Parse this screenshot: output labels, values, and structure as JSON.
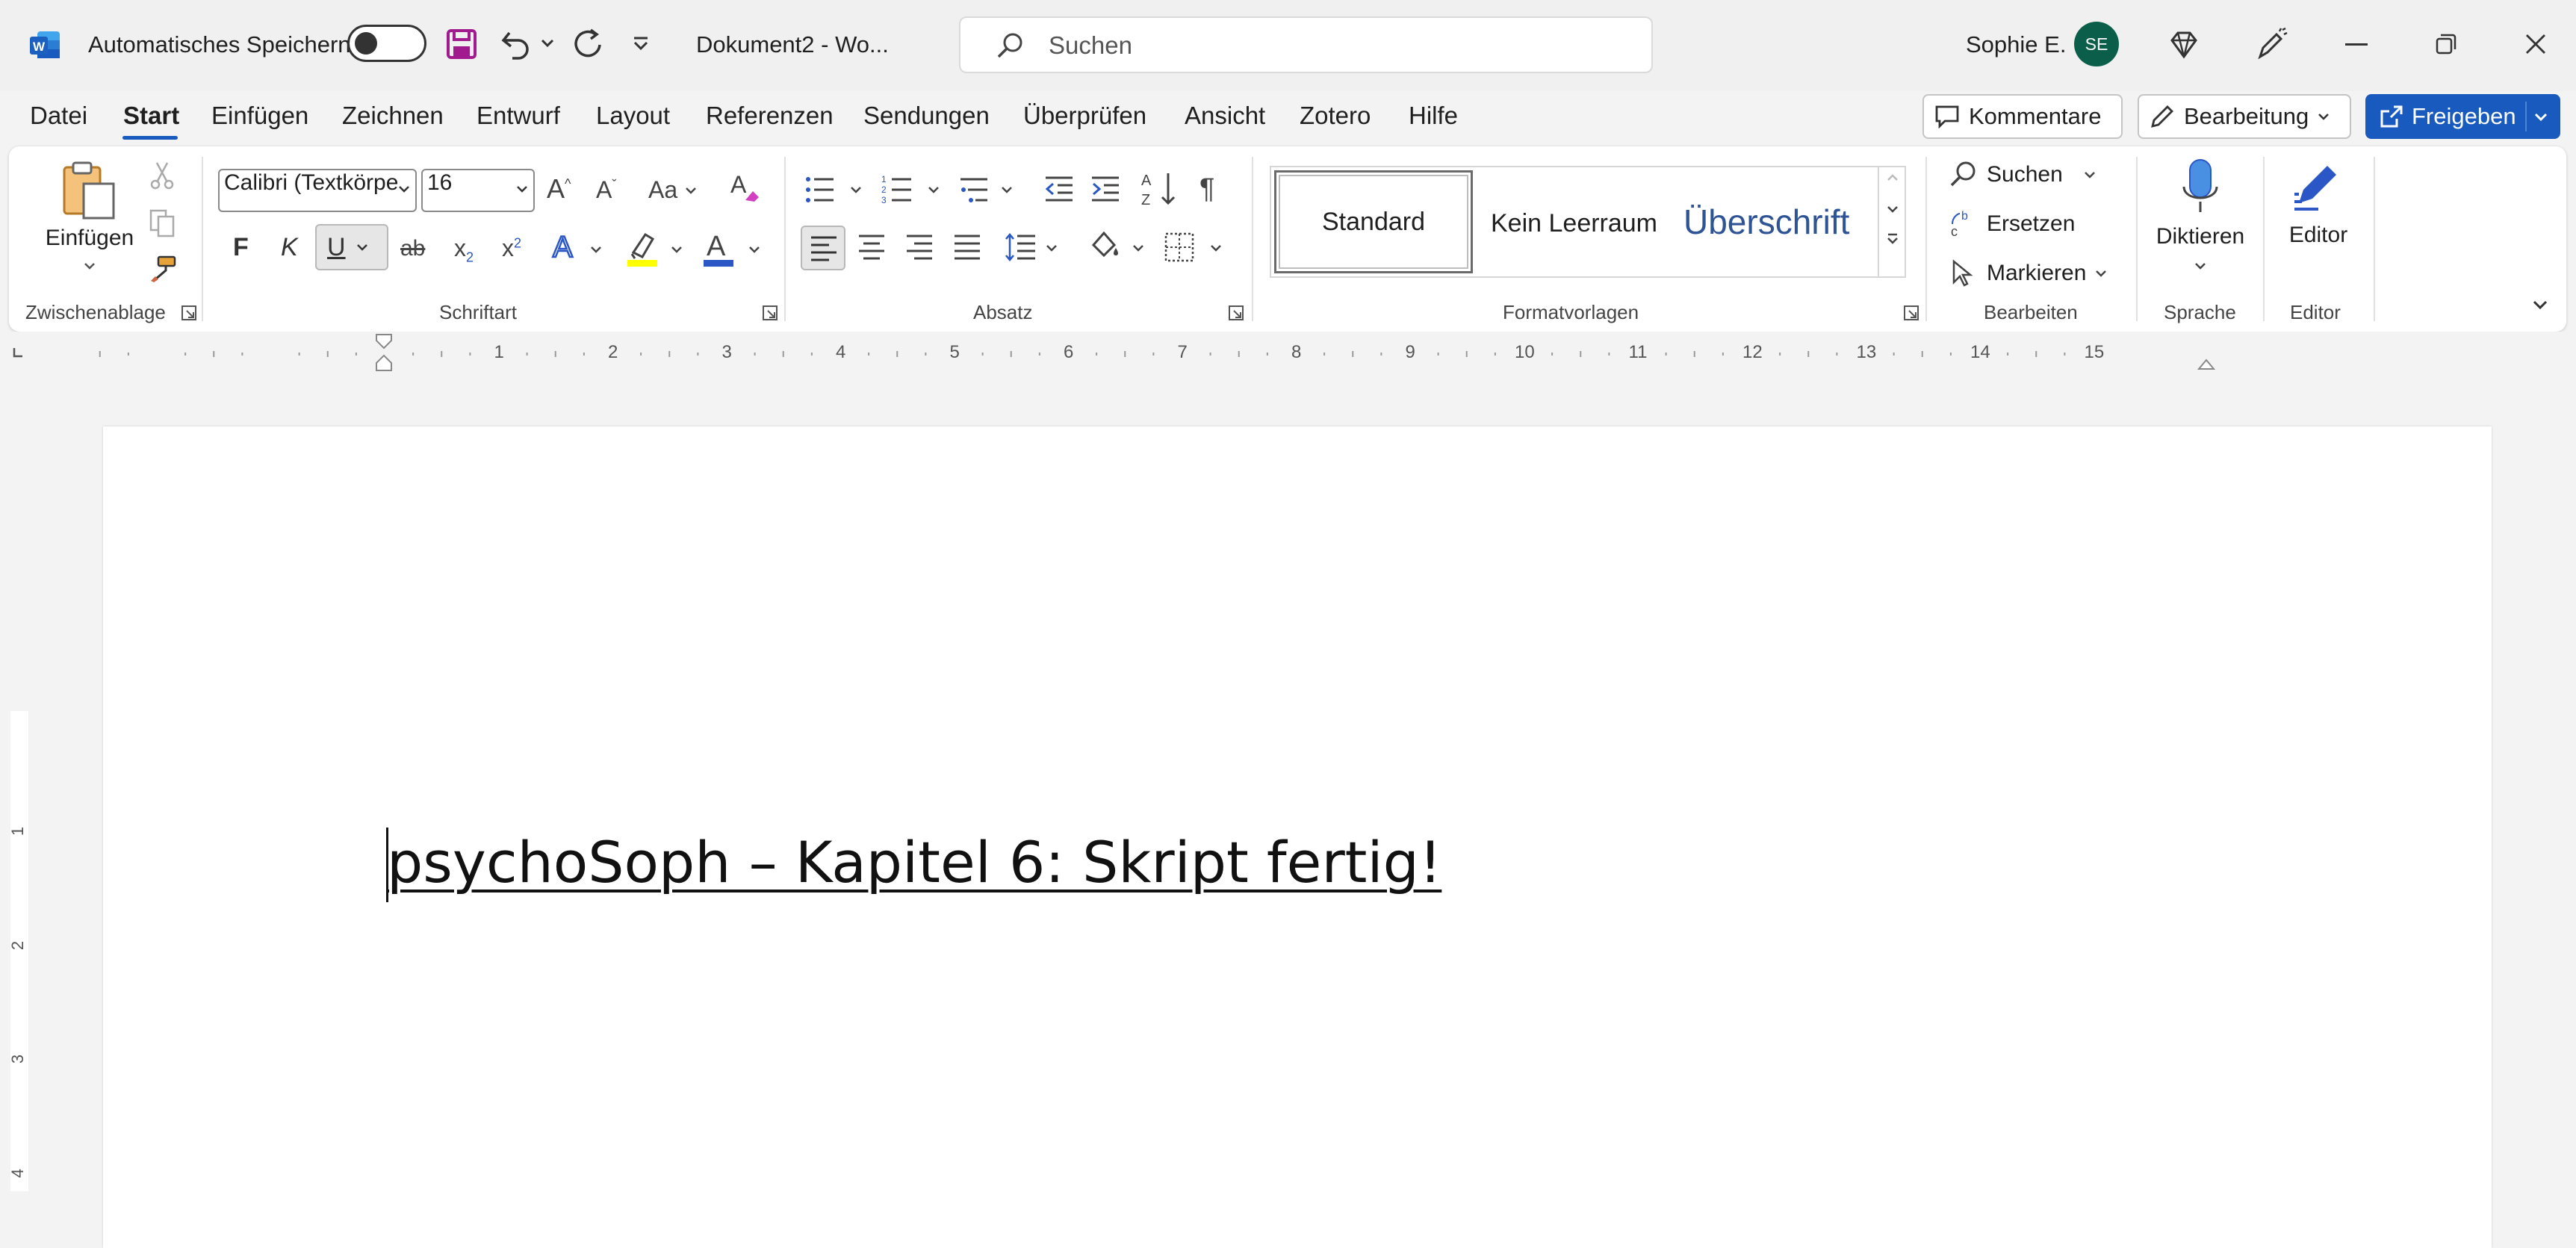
{
  "titlebar": {
    "autosave_label": "Automatisches Speichern",
    "doc_title": "Dokument2  -  Wo...",
    "search_placeholder": "Suchen",
    "user_name": "Sophie E.",
    "user_initials": "SE"
  },
  "menu": {
    "items": [
      "Datei",
      "Start",
      "Einfügen",
      "Zeichnen",
      "Entwurf",
      "Layout",
      "Referenzen",
      "Sendungen",
      "Überprüfen",
      "Ansicht",
      "Zotero",
      "Hilfe"
    ],
    "comments_label": "Kommentare",
    "editing_label": "Bearbeitung",
    "share_label": "Freigeben"
  },
  "ribbon": {
    "clipboard": {
      "paste_label": "Einfügen",
      "group_label": "Zwischenablage"
    },
    "font": {
      "font_name": "Calibri (Textkörpe",
      "font_size": "16",
      "change_case": "Aa",
      "bold": "F",
      "italic": "K",
      "underline": "U",
      "strike": "ab",
      "subscript": "x",
      "subscript_mark": "2",
      "superscript": "x",
      "superscript_mark": "2",
      "group_label": "Schriftart"
    },
    "paragraph": {
      "group_label": "Absatz"
    },
    "styles": {
      "items": [
        "Standard",
        "Kein Leerraum",
        "Überschrift"
      ],
      "group_label": "Formatvorlagen"
    },
    "editing": {
      "find": "Suchen",
      "replace": "Ersetzen",
      "select": "Markieren",
      "group_label": "Bearbeiten"
    },
    "voice": {
      "dictate": "Diktieren",
      "group_label": "Sprache"
    },
    "editor": {
      "label": "Editor",
      "group_label": "Editor"
    }
  },
  "ruler": {
    "numbers": [
      "1",
      "2",
      "3",
      "4",
      "5",
      "6",
      "7",
      "8",
      "9",
      "10",
      "11",
      "12",
      "13",
      "14",
      "15"
    ],
    "vertical_numbers": [
      "1",
      "2",
      "3",
      "4"
    ]
  },
  "document": {
    "text": "psychoSoph – Kapitel 6: Skript fertig!"
  },
  "colors": {
    "accent": "#185abd",
    "avatar": "#0b5f4a",
    "highlight": "#ffff00",
    "font_color": "#2b57c6",
    "save_icon": "#a11a8e"
  },
  "icons": {
    "save": "save-icon",
    "undo": "undo-icon",
    "redo": "redo-icon",
    "search": "search-icon",
    "diamond": "premium-diamond-icon",
    "pen": "designer-pen-icon",
    "minimize": "minimize-icon",
    "restore": "restore-icon",
    "close": "close-icon"
  }
}
